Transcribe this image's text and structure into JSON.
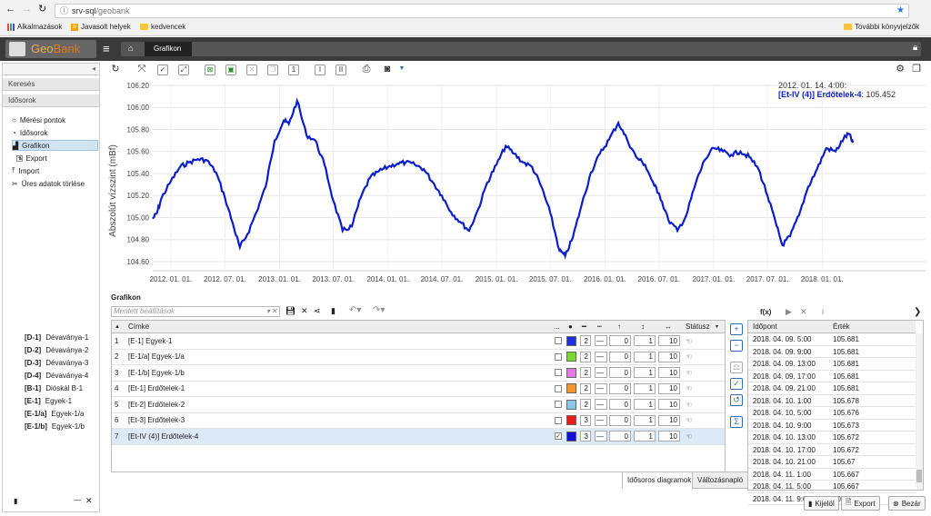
{
  "browser": {
    "url_host": "srv-sql",
    "url_path": "/geobank",
    "bookmarks": [
      "Alkalmazások",
      "Javasolt helyek",
      "kedvencek"
    ],
    "other_bookmarks": "További könyvjelzők"
  },
  "app": {
    "logo_geo": "Geo",
    "logo_bank": "Bank",
    "breadcrumb": "Grafikon"
  },
  "left": {
    "search_header": "Keresés",
    "timeseries_header": "Idősorok",
    "tree": [
      {
        "label": "Mérési pontok",
        "icon": "circle-icon"
      },
      {
        "label": "Idősorok",
        "icon": "clock-icon"
      },
      {
        "label": "Grafikon",
        "icon": "chart-icon"
      },
      {
        "label": "Export",
        "icon": "download-icon"
      },
      {
        "label": "Import",
        "icon": "upload-icon"
      },
      {
        "label": "Üres adatok törlése",
        "icon": "scissors-icon"
      }
    ],
    "devices": [
      {
        "code": "[D-1]",
        "name": "Dévaványa-1"
      },
      {
        "code": "[D-2]",
        "name": "Dévaványa-2"
      },
      {
        "code": "[D-3]",
        "name": "Dévaványa-3"
      },
      {
        "code": "[D-4]",
        "name": "Dévaványa-4"
      },
      {
        "code": "[B-1]",
        "name": "Dióskál B-1"
      },
      {
        "code": "[E-1]",
        "name": "Egyek-1"
      },
      {
        "code": "[E-1/a]",
        "name": "Egyek-1/a"
      },
      {
        "code": "[E-1/b]",
        "name": "Egyek-1/b"
      }
    ]
  },
  "chart_data": {
    "type": "line",
    "ylabel": "Abszolút vízszint (mBf)",
    "yticks": [
      "106.20",
      "106.00",
      "105.80",
      "105.60",
      "105.40",
      "105.20",
      "105.00",
      "104.80",
      "104.60"
    ],
    "ylim": [
      104.55,
      106.2
    ],
    "xlim": [
      "2011-11-01",
      "2018-12-15"
    ],
    "xticks": [
      "2012. 01. 01.",
      "2012. 07. 01.",
      "2013. 01. 01.",
      "2013. 07. 01.",
      "2014. 01. 01.",
      "2014. 07. 01.",
      "2015. 01. 01.",
      "2015. 07. 01.",
      "2016. 01. 01.",
      "2016. 07. 01.",
      "2017. 01. 01.",
      "2017. 07. 01.",
      "2018. 01. 01."
    ],
    "tooltip": {
      "time": "2012. 01. 14. 4:00:",
      "series": "[Et-IV (4)] Erdőtelek-4",
      "value": ": 105.452"
    },
    "color": "#0a1ecc",
    "series": [
      {
        "name": "[Et-IV (4)] Erdőtelek-4",
        "x": [
          "2011-11-01",
          "2011-11-15",
          "2011-12-01",
          "2012-01-01",
          "2012-02-01",
          "2012-03-01",
          "2012-04-01",
          "2012-05-01",
          "2012-06-01",
          "2012-07-01",
          "2012-08-01",
          "2012-08-20",
          "2012-09-15",
          "2012-10-15",
          "2012-11-15",
          "2012-12-15",
          "2013-01-15",
          "2013-02-01",
          "2013-03-01",
          "2013-04-01",
          "2013-05-01",
          "2013-06-01",
          "2013-07-01",
          "2013-08-01",
          "2013-09-01",
          "2013-10-01",
          "2013-11-01",
          "2013-12-01",
          "2014-01-01",
          "2014-02-01",
          "2014-03-01",
          "2014-04-01",
          "2014-05-01",
          "2014-06-01",
          "2014-07-01",
          "2014-08-01",
          "2014-09-01",
          "2014-10-01",
          "2014-11-01",
          "2014-12-01",
          "2015-01-01",
          "2015-02-01",
          "2015-03-01",
          "2015-04-01",
          "2015-05-01",
          "2015-06-01",
          "2015-07-01",
          "2015-08-01",
          "2015-08-20",
          "2015-09-15",
          "2015-10-15",
          "2015-11-15",
          "2015-12-15",
          "2016-01-15",
          "2016-02-15",
          "2016-03-15",
          "2016-04-15",
          "2016-05-15",
          "2016-06-15",
          "2016-07-01",
          "2016-08-01",
          "2016-09-01",
          "2016-10-01",
          "2016-11-01",
          "2016-12-01",
          "2017-01-01",
          "2017-02-01",
          "2017-03-01",
          "2017-04-01",
          "2017-05-01",
          "2017-06-01",
          "2017-07-01",
          "2017-08-01",
          "2017-08-20",
          "2017-09-15",
          "2017-10-15",
          "2017-11-15",
          "2017-12-15",
          "2018-01-15",
          "2018-02-15",
          "2018-03-15",
          "2018-04-01",
          "2018-04-15"
        ],
        "values": [
          104.99,
          105.04,
          105.18,
          105.33,
          105.46,
          105.5,
          105.53,
          105.52,
          105.41,
          105.18,
          104.9,
          104.73,
          104.85,
          105.05,
          105.28,
          105.7,
          105.88,
          105.85,
          106.06,
          105.75,
          105.7,
          105.48,
          105.15,
          104.88,
          104.92,
          105.18,
          105.36,
          105.42,
          105.46,
          105.49,
          105.5,
          105.48,
          105.44,
          105.32,
          105.2,
          105.05,
          104.96,
          104.88,
          105.08,
          105.32,
          105.48,
          105.65,
          105.58,
          105.5,
          105.46,
          105.28,
          105.04,
          104.7,
          104.65,
          104.82,
          105.12,
          105.41,
          105.58,
          105.71,
          105.86,
          105.71,
          105.55,
          105.48,
          105.29,
          105.22,
          104.98,
          104.88,
          105.02,
          105.31,
          105.52,
          105.63,
          105.6,
          105.57,
          105.6,
          105.55,
          105.44,
          105.2,
          104.92,
          104.75,
          104.83,
          105.02,
          105.28,
          105.44,
          105.63,
          105.6,
          105.72,
          105.76,
          105.68
        ]
      }
    ]
  },
  "toolbar": {
    "title": "Grafikon",
    "saved_placeholder": "Mentett beállítások"
  },
  "table": {
    "headers": {
      "label": "Címke",
      "status": "Státusz",
      "more": "..."
    },
    "rows": [
      {
        "n": "1",
        "label": "[E-1] Egyek-1",
        "color": "#1f2fd6",
        "width": "2",
        "v1": "0",
        "v2": "1",
        "v3": "10",
        "checked": ""
      },
      {
        "n": "2",
        "label": "[E-1/a] Egyek-1/a",
        "color": "#7bd638",
        "width": "2",
        "v1": "0",
        "v2": "1",
        "v3": "10",
        "checked": ""
      },
      {
        "n": "3",
        "label": "[E-1/b] Egyek-1/b",
        "color": "#e27be0",
        "width": "2",
        "v1": "0",
        "v2": "1",
        "v3": "10",
        "checked": ""
      },
      {
        "n": "4",
        "label": "[Et-1] Erdőtelek-1",
        "color": "#f0962e",
        "width": "2",
        "v1": "0",
        "v2": "1",
        "v3": "10",
        "checked": ""
      },
      {
        "n": "5",
        "label": "[Et-2] Erdőtelek-2",
        "color": "#8ec6e8",
        "width": "2",
        "v1": "0",
        "v2": "1",
        "v3": "10",
        "checked": ""
      },
      {
        "n": "6",
        "label": "[Et-3] Erdőtelek-3",
        "color": "#e01e1e",
        "width": "3",
        "v1": "0",
        "v2": "1",
        "v3": "10",
        "checked": ""
      },
      {
        "n": "7",
        "label": "[Et-IV (4)] Erdőtelek-4",
        "color": "#1010cc",
        "width": "3",
        "v1": "0",
        "v2": "1",
        "v3": "10",
        "checked": "✓"
      }
    ],
    "tabs": [
      "Idősoros diagramok",
      "Változásnapló"
    ]
  },
  "values_panel": {
    "fx": "f(x)",
    "headers": {
      "time": "Időpont",
      "value": "Érték"
    },
    "rows": [
      {
        "t": "2018. 04. 09. 5:00",
        "v": "105.681"
      },
      {
        "t": "2018. 04. 09. 9:00",
        "v": "105.681"
      },
      {
        "t": "2018. 04. 09. 13:00",
        "v": "105.681"
      },
      {
        "t": "2018. 04. 09. 17:00",
        "v": "105.681"
      },
      {
        "t": "2018. 04. 09. 21:00",
        "v": "105.681"
      },
      {
        "t": "2018. 04. 10. 1:00",
        "v": "105.678"
      },
      {
        "t": "2018. 04. 10. 5:00",
        "v": "105.676"
      },
      {
        "t": "2018. 04. 10. 9:00",
        "v": "105.673"
      },
      {
        "t": "2018. 04. 10. 13:00",
        "v": "105.672"
      },
      {
        "t": "2018. 04. 10. 17:00",
        "v": "105.672"
      },
      {
        "t": "2018. 04. 10. 21:00",
        "v": "105.67"
      },
      {
        "t": "2018. 04. 11. 1:00",
        "v": "105.667"
      },
      {
        "t": "2018. 04. 11. 5:00",
        "v": "105.667"
      },
      {
        "t": "2018. 04. 11. 9:00",
        "v": "105.665"
      }
    ]
  },
  "footer": {
    "select": "Kijelöl",
    "export": "Export",
    "close": "Bezár"
  }
}
